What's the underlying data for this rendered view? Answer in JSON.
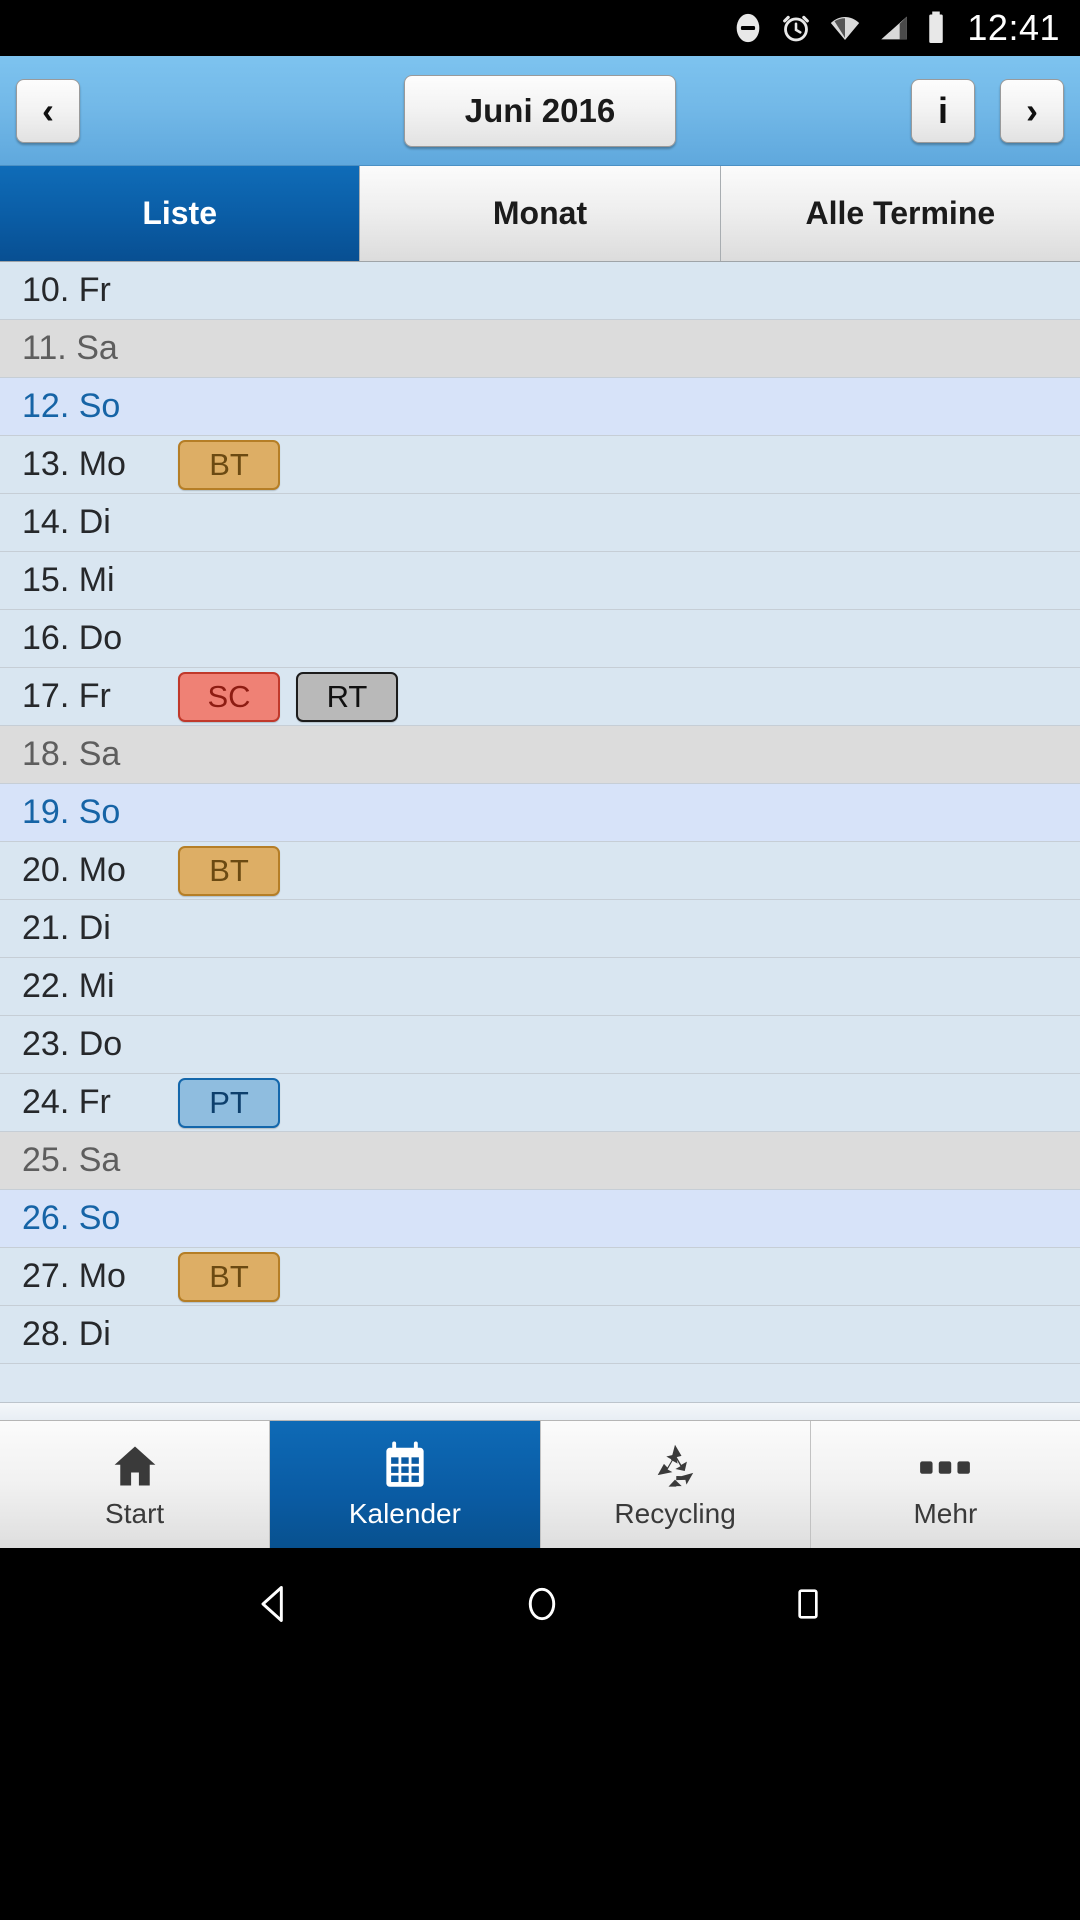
{
  "status_bar": {
    "icons": [
      "do-not-disturb-icon",
      "alarm-icon",
      "wifi-icon",
      "signal-icon",
      "battery-icon"
    ],
    "time": "12:41"
  },
  "header": {
    "prev_label": "‹",
    "title": "Juni 2016",
    "info_label": "i",
    "next_label": "›"
  },
  "tabs": [
    {
      "label": "Liste",
      "active": true
    },
    {
      "label": "Monat",
      "active": false
    },
    {
      "label": "Alle Termine",
      "active": false
    }
  ],
  "days": [
    {
      "label": "10. Fr",
      "type": "weekday",
      "badges": []
    },
    {
      "label": "11. Sa",
      "type": "sat",
      "badges": []
    },
    {
      "label": "12. So",
      "type": "sun",
      "badges": []
    },
    {
      "label": "13. Mo",
      "type": "weekday",
      "badges": [
        {
          "code": "BT",
          "style": "bt"
        }
      ]
    },
    {
      "label": "14. Di",
      "type": "weekday",
      "badges": []
    },
    {
      "label": "15. Mi",
      "type": "weekday",
      "badges": []
    },
    {
      "label": "16. Do",
      "type": "weekday",
      "badges": []
    },
    {
      "label": "17. Fr",
      "type": "weekday",
      "badges": [
        {
          "code": "SC",
          "style": "sc"
        },
        {
          "code": "RT",
          "style": "rt"
        }
      ]
    },
    {
      "label": "18. Sa",
      "type": "sat",
      "badges": []
    },
    {
      "label": "19. So",
      "type": "sun",
      "badges": []
    },
    {
      "label": "20. Mo",
      "type": "weekday",
      "badges": [
        {
          "code": "BT",
          "style": "bt"
        }
      ]
    },
    {
      "label": "21. Di",
      "type": "weekday",
      "badges": []
    },
    {
      "label": "22. Mi",
      "type": "weekday",
      "badges": []
    },
    {
      "label": "23. Do",
      "type": "weekday",
      "badges": []
    },
    {
      "label": "24. Fr",
      "type": "weekday",
      "badges": [
        {
          "code": "PT",
          "style": "pt"
        }
      ]
    },
    {
      "label": "25. Sa",
      "type": "sat",
      "badges": []
    },
    {
      "label": "26. So",
      "type": "sun",
      "badges": []
    },
    {
      "label": "27. Mo",
      "type": "weekday",
      "badges": [
        {
          "code": "BT",
          "style": "bt"
        }
      ]
    },
    {
      "label": "28. Di",
      "type": "weekday",
      "badges": []
    }
  ],
  "bottom_nav": [
    {
      "label": "Start",
      "icon": "home-icon",
      "active": false
    },
    {
      "label": "Kalender",
      "icon": "calendar-icon",
      "active": true
    },
    {
      "label": "Recycling",
      "icon": "recycle-icon",
      "active": false
    },
    {
      "label": "Mehr",
      "icon": "more-dots-icon",
      "active": false
    }
  ],
  "android_nav": [
    {
      "icon": "back-triangle-icon"
    },
    {
      "icon": "home-circle-icon"
    },
    {
      "icon": "recents-square-icon"
    }
  ],
  "colors": {
    "header_blue": "#73b9e8",
    "accent_blue": "#0a5ba3",
    "sunday_text": "#1664a6",
    "row_weekday_bg": "#d9e6f1",
    "row_saturday_bg": "#dcdcdc",
    "row_sunday_bg": "#d7e3f9",
    "badge_bt": "#ddae65",
    "badge_sc": "#ef8175",
    "badge_rt": "#b9b9b9",
    "badge_pt": "#8fbddf"
  }
}
